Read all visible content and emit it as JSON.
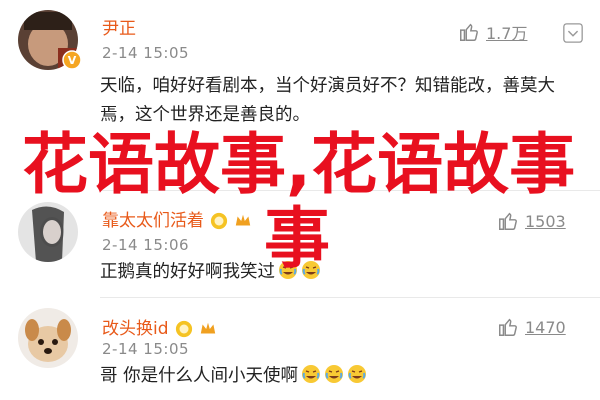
{
  "comments": [
    {
      "username": "尹正",
      "date": "2-14 15:05",
      "text": "天临，咱好好看剧本，当个好演员好不？知错能改，善莫大焉，这个世界还是善良的。",
      "likes": "1.7万"
    },
    {
      "username": "靠太太们活着",
      "date": "2-14 15:06",
      "text": "正鹅真的好好啊我笑过",
      "likes": "1503"
    },
    {
      "username": "改头换id",
      "date": "2-14 15:05",
      "text": "哥 你是什么人间小天使啊",
      "likes": "1470"
    }
  ],
  "overlay": {
    "line1": "花语故事,花语故事",
    "line2": "事"
  },
  "colors": {
    "username": "#e85a1a",
    "overlay_text": "#e8101f",
    "meta": "#8a8a8a"
  },
  "icons": [
    "thumbs-up-icon",
    "chevron-down-icon",
    "vip-badge-icon",
    "crying-laugh-emoji"
  ]
}
